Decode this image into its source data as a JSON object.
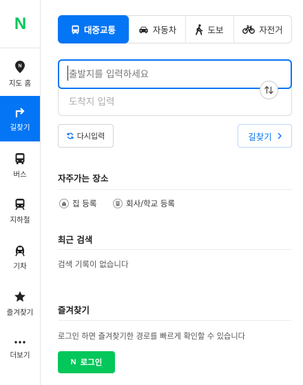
{
  "sidebar": {
    "logo": "N",
    "items": [
      {
        "label": "지도 홈",
        "icon": "map-pin-icon"
      },
      {
        "label": "길찾기",
        "icon": "turn-right-arrow-icon",
        "active": true
      },
      {
        "label": "버스",
        "icon": "bus-icon"
      },
      {
        "label": "지하철",
        "icon": "subway-icon"
      },
      {
        "label": "기차",
        "icon": "train-icon"
      },
      {
        "label": "즐겨찾기",
        "icon": "star-icon"
      },
      {
        "label": "더보기",
        "icon": "more-dots-icon"
      }
    ]
  },
  "modes": [
    {
      "label": "대중교통",
      "icon": "bus-icon",
      "active": true
    },
    {
      "label": "자동차",
      "icon": "car-icon"
    },
    {
      "label": "도보",
      "icon": "walking-person-icon"
    },
    {
      "label": "자전거",
      "icon": "bicycle-icon"
    }
  ],
  "search": {
    "start_placeholder": "출발지를 입력하세요",
    "end_placeholder": "도착지 입력",
    "swap_icon": "swap-arrows-icon"
  },
  "actions": {
    "reset_label": "다시입력",
    "route_label": "길찾기"
  },
  "frequent": {
    "title": "자주가는 장소",
    "home_label": "집 등록",
    "work_label": "회사/학교 등록"
  },
  "recent": {
    "title": "최근 검색",
    "empty": "검색 기록이 없습니다"
  },
  "favorites": {
    "title": "즐겨찾기",
    "message": "로그인 하면 즐겨찾기한 경로를 빠르게 확인할 수 있습니다",
    "login_logo": "N",
    "login_label": "로그인"
  },
  "colors": {
    "accent": "#0475f4",
    "brand": "#03c75a"
  }
}
